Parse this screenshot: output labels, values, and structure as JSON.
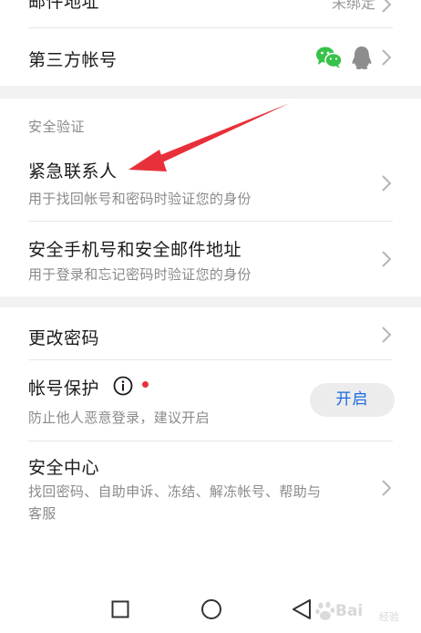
{
  "rows": {
    "email": {
      "title": "邮件地址",
      "value": "未绑定"
    },
    "third_party": {
      "title": "第三方帐号",
      "icons": [
        "wechat-icon",
        "qq-icon"
      ]
    },
    "security_section": {
      "label": "安全验证"
    },
    "emergency_contact": {
      "title": "紧急联系人",
      "subtitle": "用于找回帐号和密码时验证您的身份"
    },
    "security_phone_email": {
      "title": "安全手机号和安全邮件地址",
      "subtitle": "用于登录和忘记密码时验证您的身份"
    },
    "change_password": {
      "title": "更改密码"
    },
    "account_protection": {
      "title": "帐号保护",
      "subtitle": "防止他人恶意登录，建议开启",
      "button_label": "开启"
    },
    "security_center": {
      "title": "安全中心",
      "subtitle_line1": "找回密码、自助申诉、冻结、解冻帐号、帮助与",
      "subtitle_line2": "客服"
    }
  },
  "navbar": {
    "icons": [
      "square-icon",
      "circle-icon",
      "triangle-back-icon"
    ]
  },
  "watermark": {
    "text": "Bai",
    "sub": "经验"
  },
  "colors": {
    "accent": "#1a6be0",
    "alert_dot": "#e8303a",
    "wechat": "#37c24a",
    "arrow": "#e8303a"
  }
}
